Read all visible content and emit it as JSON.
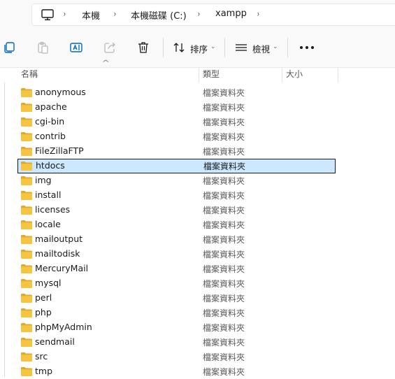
{
  "address_bar": {
    "breadcrumbs": [
      "本機",
      "本機磁碟 (C:)",
      "xampp"
    ],
    "separator": "›"
  },
  "toolbar": {
    "icons": [
      "copy-icon",
      "paste-icon",
      "rename-icon",
      "share-icon",
      "delete-icon"
    ],
    "sort_label": "排序",
    "view_label": "檢視",
    "more_label": "更多選項"
  },
  "columns": {
    "name": "名稱",
    "type": "類型",
    "size": "大小"
  },
  "files": [
    {
      "name": "anonymous",
      "type": "檔案資料夾"
    },
    {
      "name": "apache",
      "type": "檔案資料夾"
    },
    {
      "name": "cgi-bin",
      "type": "檔案資料夾"
    },
    {
      "name": "contrib",
      "type": "檔案資料夾"
    },
    {
      "name": "FileZillaFTP",
      "type": "檔案資料夾"
    },
    {
      "name": "htdocs",
      "type": "檔案資料夾",
      "selected": true
    },
    {
      "name": "img",
      "type": "檔案資料夾"
    },
    {
      "name": "install",
      "type": "檔案資料夾"
    },
    {
      "name": "licenses",
      "type": "檔案資料夾"
    },
    {
      "name": "locale",
      "type": "檔案資料夾"
    },
    {
      "name": "mailoutput",
      "type": "檔案資料夾"
    },
    {
      "name": "mailtodisk",
      "type": "檔案資料夾"
    },
    {
      "name": "MercuryMail",
      "type": "檔案資料夾"
    },
    {
      "name": "mysql",
      "type": "檔案資料夾"
    },
    {
      "name": "perl",
      "type": "檔案資料夾"
    },
    {
      "name": "php",
      "type": "檔案資料夾"
    },
    {
      "name": "phpMyAdmin",
      "type": "檔案資料夾"
    },
    {
      "name": "sendmail",
      "type": "檔案資料夾"
    },
    {
      "name": "src",
      "type": "檔案資料夾"
    },
    {
      "name": "tmp",
      "type": "檔案資料夾"
    }
  ],
  "colors": {
    "folder": "#f5c542",
    "folder_dark": "#e2a82a",
    "selection_fill": "#cce8ff",
    "accent": "#0067c0"
  }
}
